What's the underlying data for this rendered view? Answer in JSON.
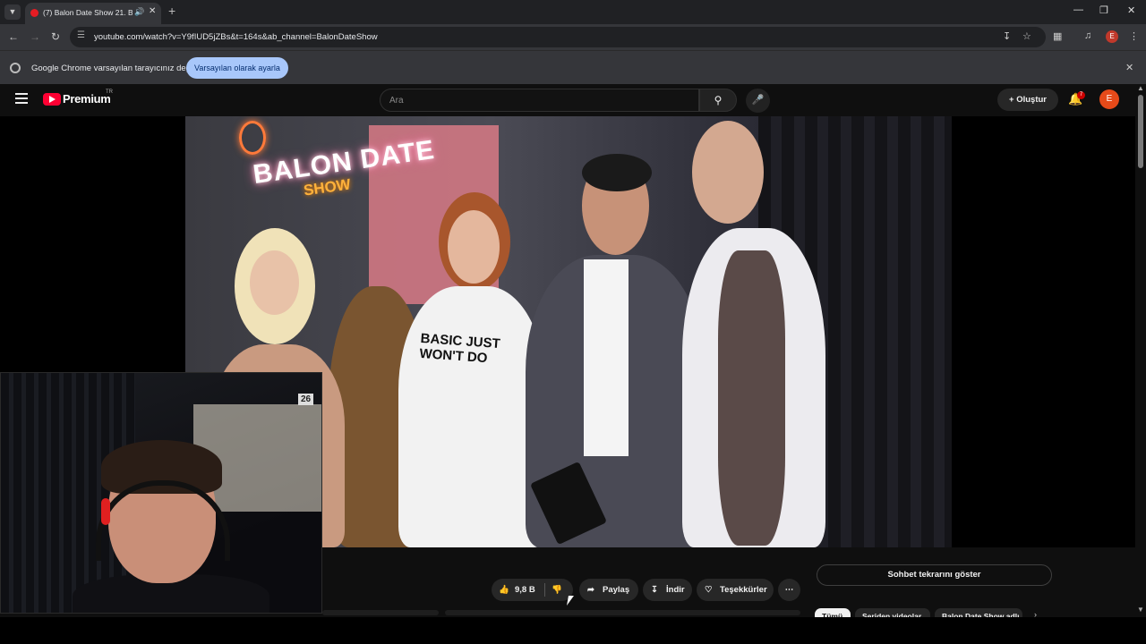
{
  "browser": {
    "tab_title": "(7) Balon Date Show 21. Bö",
    "new_tab_symbol": "+",
    "url": "youtube.com/watch?v=Y9fIUD5jZBs&t=164s&ab_channel=BalonDateShow",
    "profile_initial": "E"
  },
  "infobar": {
    "message": "Google Chrome varsayılan tarayıcınız değil",
    "button_label": "Varsayılan olarak ayarla"
  },
  "youtube": {
    "brand": "Premium",
    "country": "TR",
    "search_placeholder": "Ara",
    "create_label": "Oluştur",
    "notification_count": "7",
    "avatar_initial": "E"
  },
  "video": {
    "neon_title": "BALON DATE",
    "neon_subtitle": "SHOW",
    "shirt_text_line1": "BASIC JUST",
    "shirt_text_line2": "WON'T DO",
    "webcam_badge": "26"
  },
  "actions": {
    "like_count": "9,8 B",
    "share_label": "Paylaş",
    "download_label": "İndir",
    "thanks_label": "Teşekkürler",
    "more_label": "⋯"
  },
  "chat": {
    "show_replay_label": "Sohbet tekrarını göster"
  },
  "chips": [
    "Tümü",
    "Seriden videolar",
    "Balon Date Show adlı"
  ]
}
